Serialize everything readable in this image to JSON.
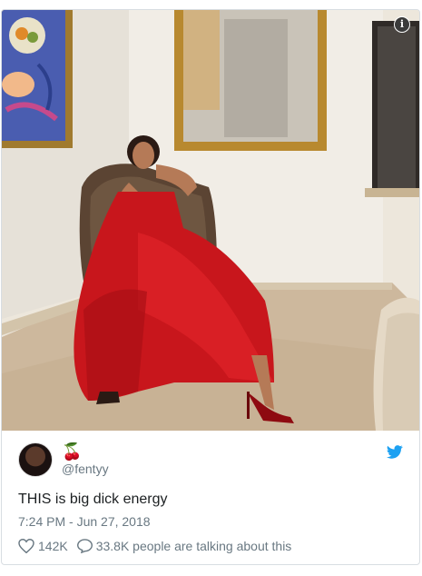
{
  "media": {
    "info_glyph": "i",
    "alt_hint_icon": "info-icon"
  },
  "author": {
    "name_emoji": "🍒",
    "handle": "@fentyy",
    "avatar_icon": "avatar",
    "platform_icon": "twitter-bird-icon"
  },
  "tweet": {
    "text": "THIS is big dick energy",
    "timestamp": "7:24 PM - Jun 27, 2018"
  },
  "actions": {
    "like_icon": "heart-icon",
    "like_count": "142K",
    "reply_icon": "speech-bubble-icon",
    "talking_text": "33.8K people are talking about this"
  },
  "colors": {
    "muted": "#697882",
    "twitter_blue": "#1da1f2",
    "border": "#d8dde2"
  }
}
